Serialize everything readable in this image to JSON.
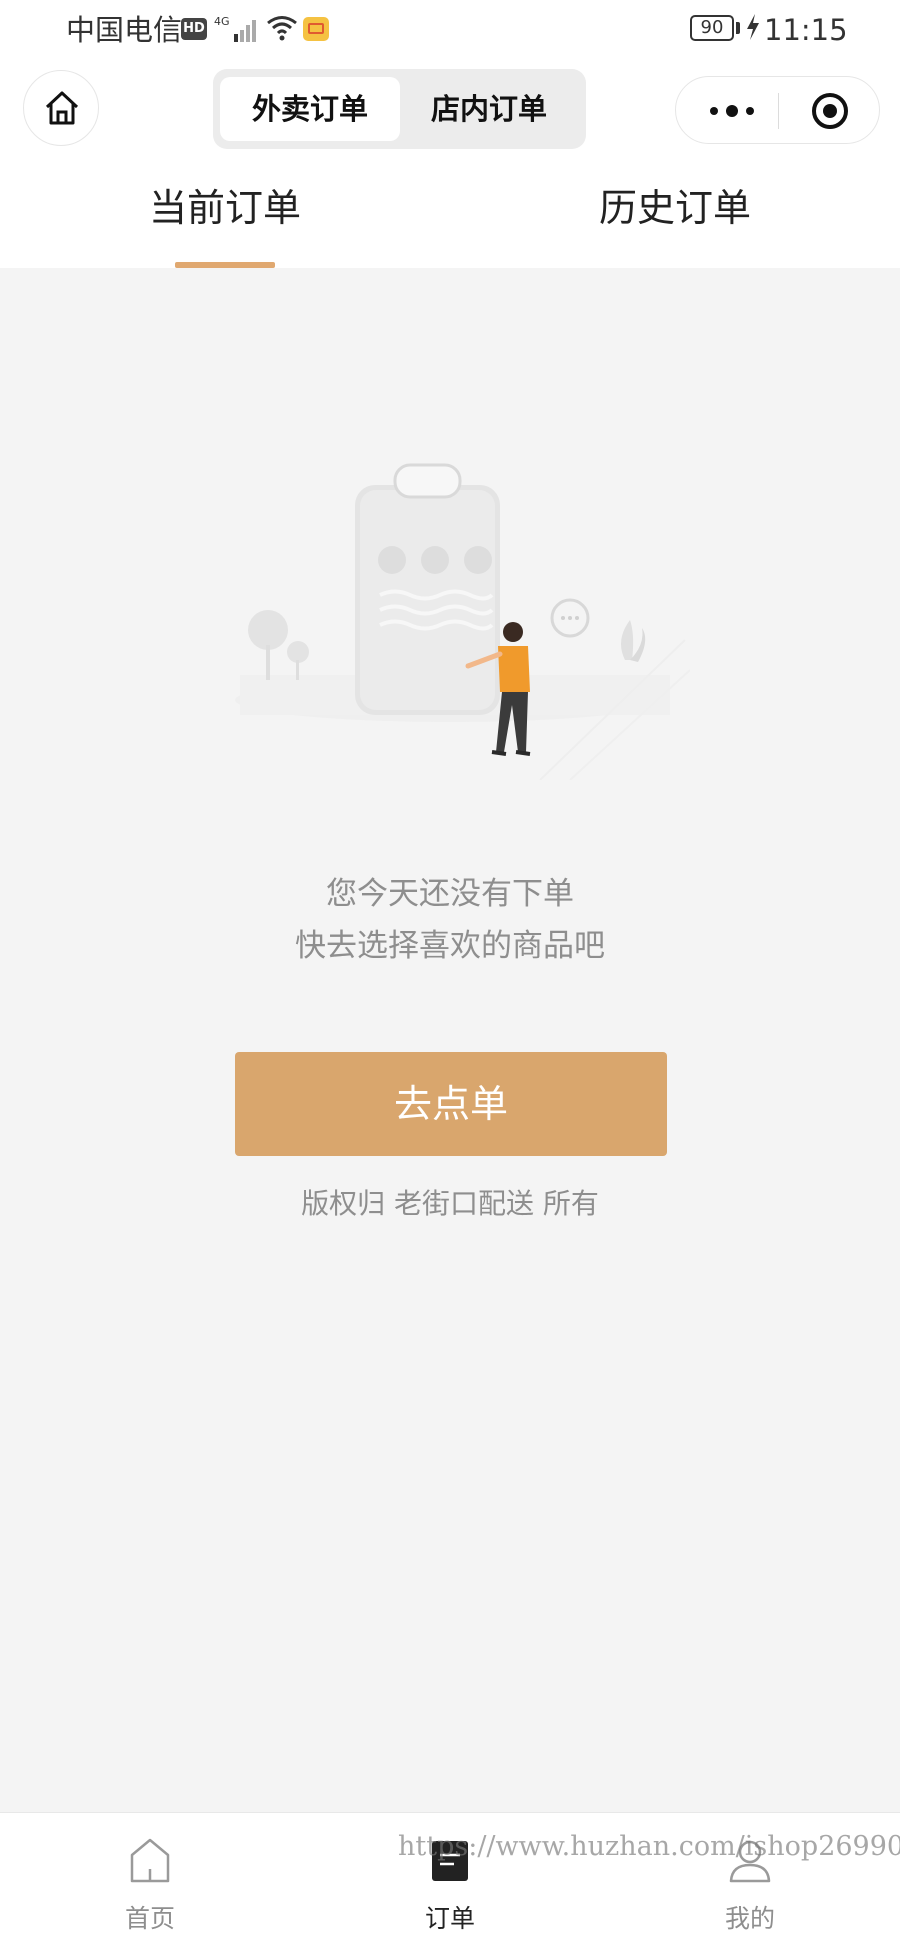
{
  "status_bar": {
    "carrier": "中国电信",
    "hd_badge": "HD",
    "network": "4G",
    "battery": "90",
    "time": "11:15"
  },
  "header": {
    "segments": [
      "外卖订单",
      "店内订单"
    ],
    "active_segment": "外卖订单"
  },
  "tabs": {
    "current": "当前订单",
    "history": "历史订单",
    "active": "当前订单",
    "indicator_color": "#e0a870"
  },
  "empty_state": {
    "line1": "您今天还没有下单",
    "line2": "快去选择喜欢的商品吧",
    "button_label": "去点单",
    "button_color": "#d9a66d",
    "copyright": "版权归 老街口配送 所有"
  },
  "bottom_nav": {
    "items": [
      {
        "label": "首页",
        "icon": "home-icon"
      },
      {
        "label": "订单",
        "icon": "orders-icon",
        "active": true
      },
      {
        "label": "我的",
        "icon": "profile-icon"
      }
    ]
  },
  "watermark": "https://www.huzhan.com/ishop26990",
  "icons": {
    "home": "home-icon",
    "more": "more-dots-icon",
    "close": "target-close-icon"
  }
}
